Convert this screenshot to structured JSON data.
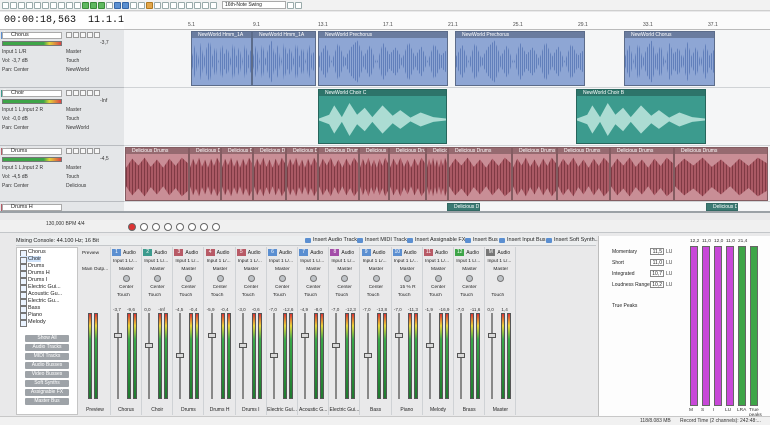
{
  "toolbar": {
    "groove": "16th-Note Swing"
  },
  "time": {
    "timecode": "00:00:18,563",
    "measure": "11.1.169"
  },
  "ruler": {
    "marks": [
      "5.1",
      "9.1",
      "13.1",
      "17.1",
      "21.1",
      "25.1",
      "29.1",
      "33.1",
      "37.1"
    ]
  },
  "tracks": [
    {
      "num": "1",
      "name": "Chorus",
      "input": "Input 1 L/R",
      "output": "Master",
      "vol": "Vol: -3,7 dB",
      "pan": "Pan: Center",
      "touch": "Touch",
      "auto": "NewWorld",
      "db": "-3,7",
      "color": "#5b8fd1"
    },
    {
      "num": "2",
      "name": "Choir",
      "input": "Input 1 L,Input 2 R",
      "output": "Master",
      "vol": "Vol: -0,0 dB",
      "pan": "Pan: Center",
      "touch": "Touch",
      "auto": "NewWorld",
      "db": "-Inf",
      "color": "#3c9b8e"
    },
    {
      "num": "3",
      "name": "Drums",
      "input": "Input 1 L,Input 2 R",
      "output": "Master",
      "vol": "Vol: -4,5 dB",
      "pan": "Pan: Center",
      "touch": "Touch",
      "auto": "Delicious",
      "db": "-4,5",
      "color": "#b85a66"
    },
    {
      "num": "4",
      "name": "Drums H",
      "input": "",
      "output": "",
      "vol": "",
      "pan": "",
      "touch": "",
      "auto": "",
      "db": "",
      "color": "#b85a66"
    }
  ],
  "clips": {
    "chorus": [
      "NewWorld Hmm_1A",
      "NewWorld Hmm_1A",
      "NewWorld Prechorus",
      "NewWorld Prechorus",
      "NewWorld Chorus"
    ],
    "choir": [
      "NewWorld Choir C",
      "NewWorld Choir B"
    ],
    "drums": [
      "Delicious Drums",
      "Delicious Drums",
      "Delicious Drums",
      "Delicious Drums",
      "Delicious Drums",
      "Delicious Drums",
      "Delicious Drums",
      "Delicious Drums",
      "Delicious Drums",
      "Delicious Drums",
      "Delicious Drums",
      "Delicious Drums",
      "Delicious Drums",
      "Delicious Drums"
    ],
    "drumsh": [
      "Delicious D",
      "Delicious D"
    ]
  },
  "transport": {
    "bpm": "130,000",
    "time_sig": "4/4",
    "bpm_label": "BPM"
  },
  "mixer": {
    "title": "Mixing Console: 44.100 Hz; 16 Bit",
    "actions": [
      "Insert Audio Track",
      "Insert MIDI Track",
      "Insert Assignable FX...",
      "Insert Bus",
      "Insert Input Bus",
      "Insert Soft Synth..."
    ],
    "tree": [
      "Chorus",
      "Choir",
      "Drums",
      "Drums H",
      "Drums I",
      "Electric Gui...",
      "Acoustic Gu...",
      "Electric Gu...",
      "Bass",
      "Piano",
      "Melody"
    ],
    "tree_buttons": [
      "Show All",
      "Audio Tracks",
      "MIDI Tracks",
      "Audio Busses",
      "Video Busses",
      "Soft Synths",
      "Assignable FX",
      "Master Bus"
    ],
    "preview": {
      "label": "Preview",
      "output": "Main Outp..."
    },
    "strips": [
      {
        "num": "1",
        "type": "Audio",
        "input": "Input 1 L/...",
        "output": "Master",
        "pan": "Center",
        "touch": "Touch",
        "db": "-3,7",
        "peak": "-9,6",
        "name": "Chorus",
        "color": "#5b8fd1"
      },
      {
        "num": "2",
        "type": "Audio",
        "input": "Input 1 L/...",
        "output": "Master",
        "pan": "Center",
        "touch": "Touch",
        "db": "0,0",
        "peak": "-Inf",
        "name": "Choir",
        "color": "#3c9b8e"
      },
      {
        "num": "3",
        "type": "Audio",
        "input": "Input 1 L/...",
        "output": "Master",
        "pan": "Center",
        "touch": "Touch",
        "db": "-4,5",
        "peak": "-0,4",
        "name": "Drums",
        "color": "#b85a66"
      },
      {
        "num": "4",
        "type": "Audio",
        "input": "Input 1 L/...",
        "output": "Master",
        "pan": "Center",
        "touch": "Touch",
        "db": "-5,9",
        "peak": "-0,4",
        "name": "Drums H",
        "color": "#b85a66"
      },
      {
        "num": "5",
        "type": "Audio",
        "input": "Input 1 L/...",
        "output": "Master",
        "pan": "Center",
        "touch": "Touch",
        "db": "-3,0",
        "peak": "-0,6",
        "name": "Drums I",
        "color": "#b85a66"
      },
      {
        "num": "6",
        "type": "Audio",
        "input": "Input 1 L/...",
        "output": "Master",
        "pan": "Center",
        "touch": "Touch",
        "db": "-7,0",
        "peak": "-12,6",
        "name": "Electric Gui...",
        "color": "#5b8fd1"
      },
      {
        "num": "7",
        "type": "Audio",
        "input": "Input 1 L/...",
        "output": "Master",
        "pan": "Center",
        "touch": "Touch",
        "db": "-4,9",
        "peak": "-8,0",
        "name": "Acoustic G...",
        "color": "#5b8fd1"
      },
      {
        "num": "8",
        "type": "Audio",
        "input": "Input 1 L/...",
        "output": "Master",
        "pan": "Center",
        "touch": "Touch",
        "db": "-7,0",
        "peak": "-12,3",
        "name": "Electric Gui...",
        "color": "#a34ca8"
      },
      {
        "num": "9",
        "type": "Audio",
        "input": "Input 1 L/...",
        "output": "Master",
        "pan": "Center",
        "touch": "Touch",
        "db": "-7,0",
        "peak": "-13,8",
        "name": "Bass",
        "color": "#5b8fd1"
      },
      {
        "num": "10",
        "type": "Audio",
        "input": "Input 1 L/...",
        "output": "Master",
        "pan": "15 % R",
        "touch": "Touch",
        "db": "-7,0",
        "peak": "-11,3",
        "name": "Piano",
        "color": "#5b8fd1"
      },
      {
        "num": "11",
        "type": "Audio",
        "input": "Input 1 L/...",
        "output": "Master",
        "pan": "Center",
        "touch": "Touch",
        "db": "-1,9",
        "peak": "-16,9",
        "name": "Melody",
        "color": "#b85a66"
      },
      {
        "num": "12",
        "type": "Audio",
        "input": "Input 1 L/...",
        "output": "Master",
        "pan": "Center",
        "touch": "Touch",
        "db": "-7,0",
        "peak": "-11,6",
        "name": "Brass",
        "color": "#3ea548"
      },
      {
        "num": "M",
        "type": "Audio",
        "input": "Input 1 L/...",
        "output": "Master",
        "pan": "",
        "touch": "Touch",
        "db": "0,0",
        "peak": "1,4",
        "name": "Master",
        "color": "#777"
      }
    ]
  },
  "loudness": {
    "rows": [
      {
        "label": "Momentary",
        "value": "11,5",
        "unit": "LU"
      },
      {
        "label": "Short",
        "value": "11,0",
        "unit": "LU"
      },
      {
        "label": "Integrated",
        "value": "10,7",
        "unit": "LU"
      },
      {
        "label": "Loudness Range",
        "value": "10,2",
        "unit": "LU"
      }
    ],
    "true_peaks": "True Peaks",
    "bars": [
      {
        "top": "12,2",
        "label": "M",
        "color": "#c848d8"
      },
      {
        "top": "11,0",
        "label": "S",
        "color": "#c848d8"
      },
      {
        "top": "12,0",
        "label": "I",
        "color": "#c848d8"
      },
      {
        "top": "11,0",
        "label": "LU",
        "color": "#c848d8"
      },
      {
        "top": "21,4",
        "label": "LRA",
        "color": "#3ea548"
      },
      {
        "top": "",
        "label": "True peaks",
        "color": "#3ea548"
      }
    ]
  },
  "status": {
    "memory": "118/8.083 MB",
    "record_time": "Record Time (2 channels): 242:48:..."
  }
}
